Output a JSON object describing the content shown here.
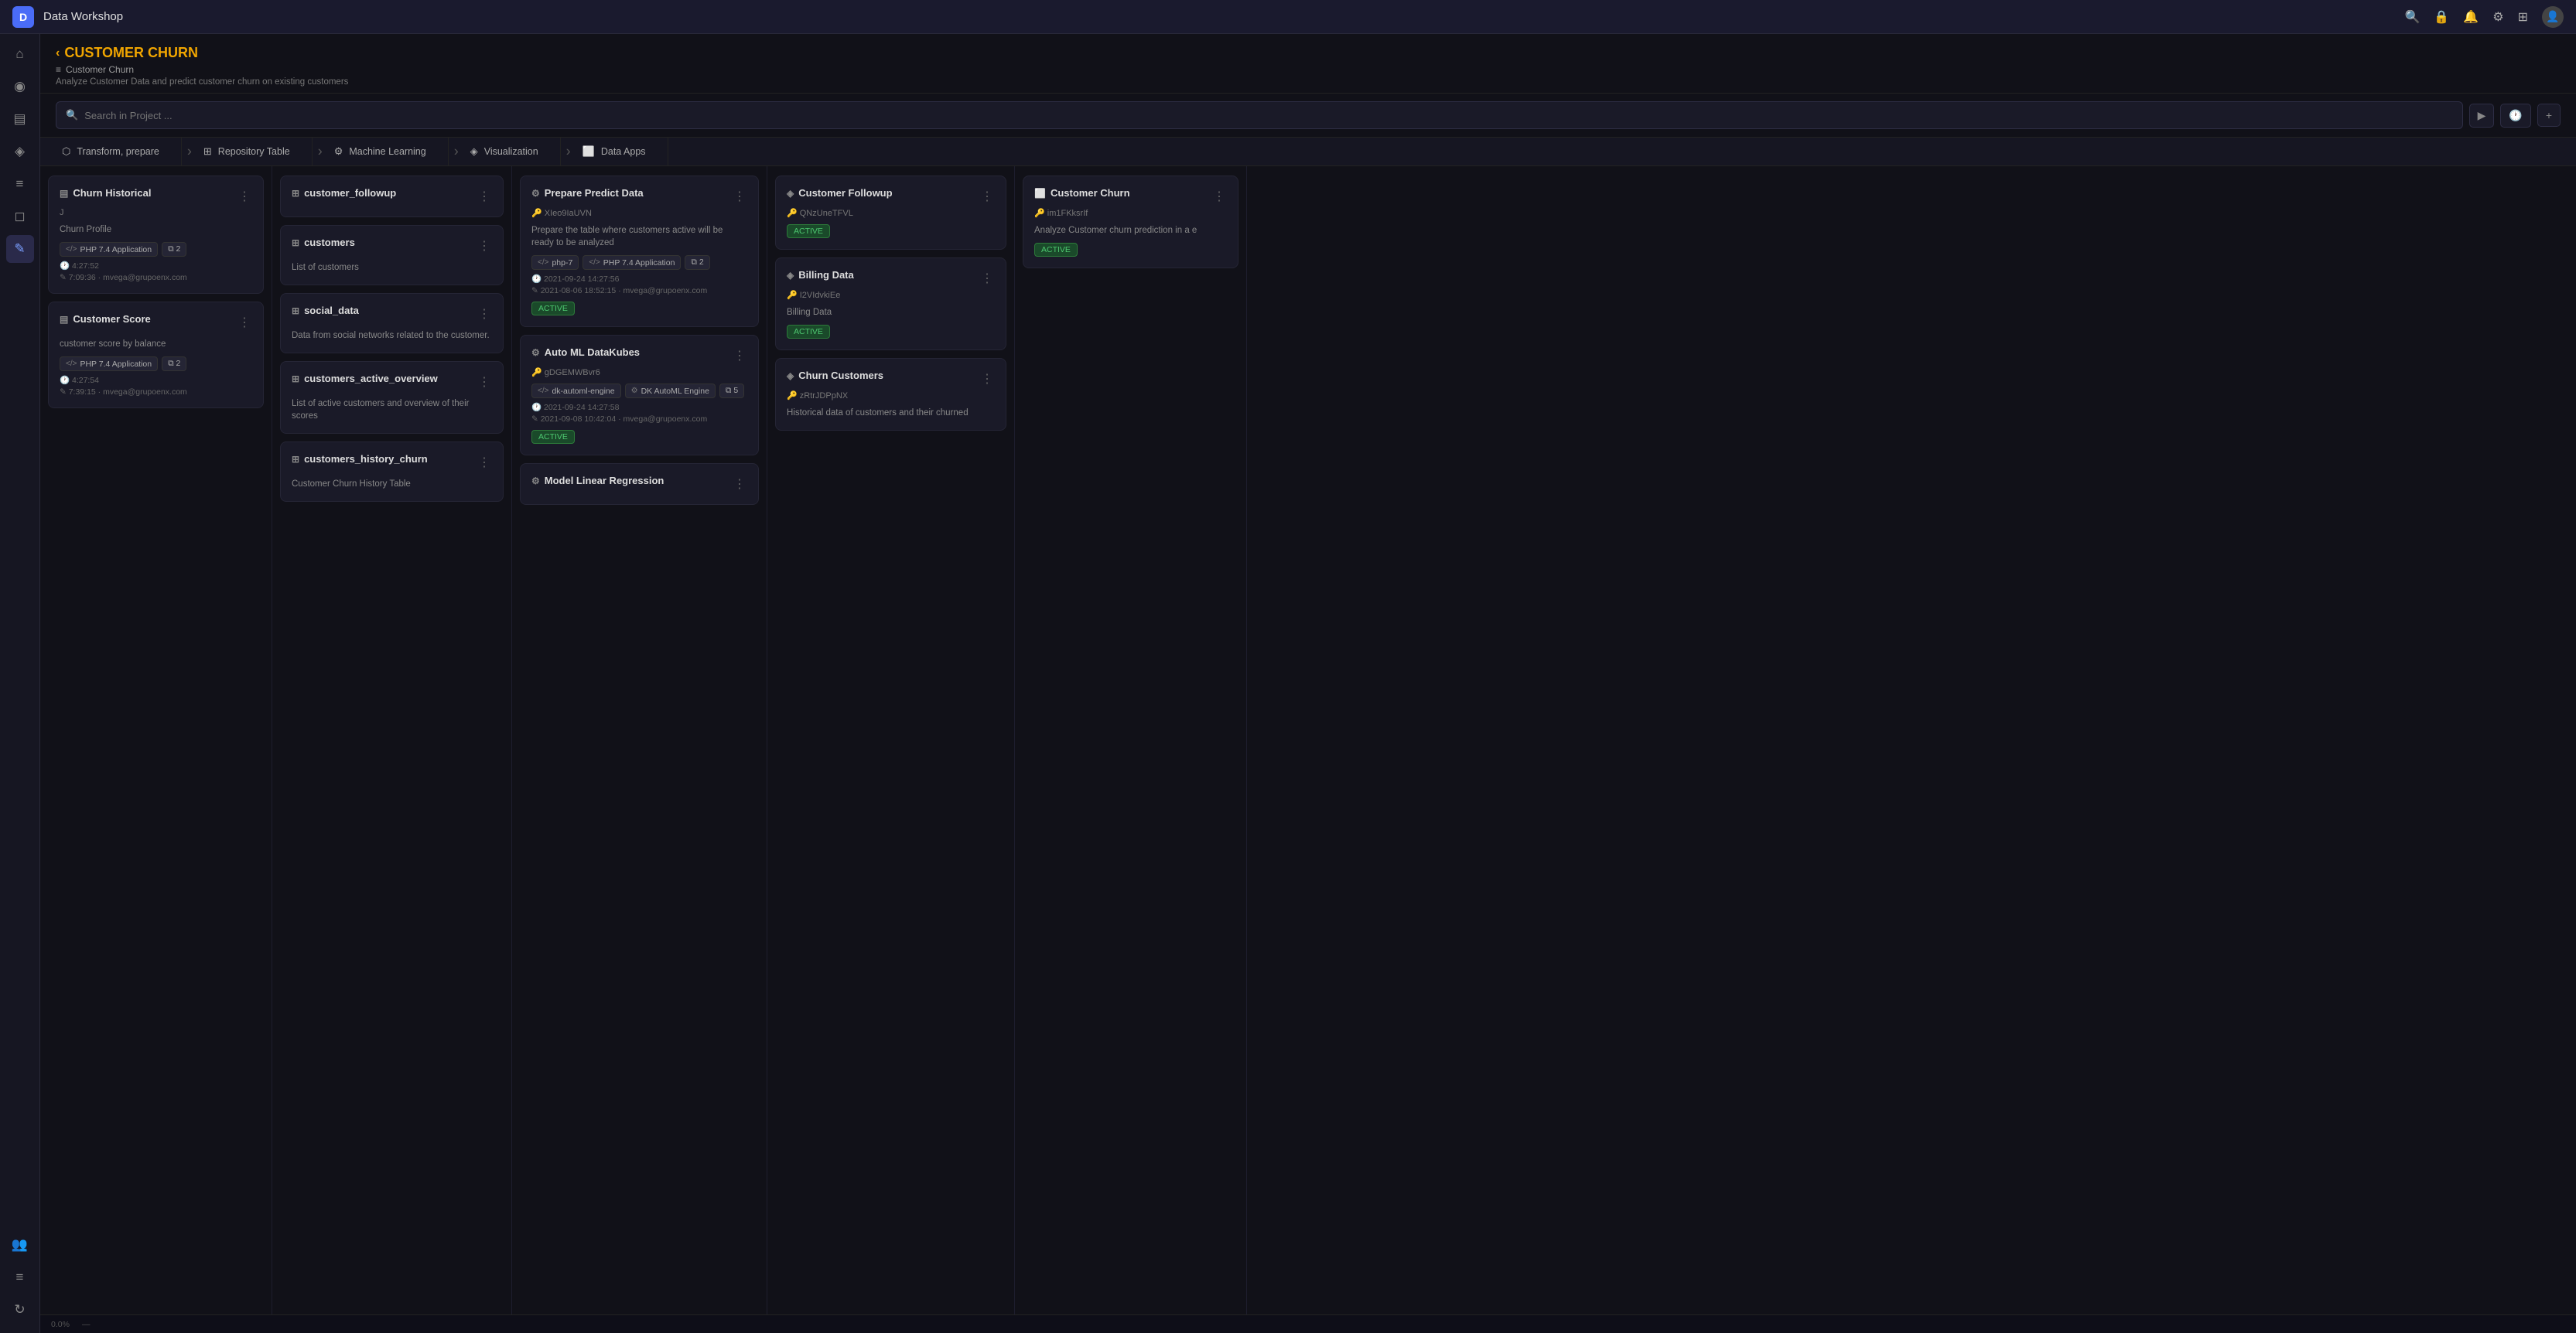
{
  "app": {
    "title": "Data Workshop",
    "logo": "D"
  },
  "topnav": {
    "icons": [
      "search",
      "lock",
      "bell",
      "settings",
      "grid",
      "user"
    ]
  },
  "sidebar": {
    "items": [
      {
        "icon": "⌂",
        "label": "home",
        "active": false
      },
      {
        "icon": "◉",
        "label": "dashboard",
        "active": false
      },
      {
        "icon": "▤",
        "label": "storage",
        "active": false
      },
      {
        "icon": "◈",
        "label": "pipeline",
        "active": false
      },
      {
        "icon": "≡",
        "label": "list",
        "active": false
      },
      {
        "icon": "✦",
        "label": "analytics",
        "active": false
      },
      {
        "icon": "✎",
        "label": "edit",
        "active": true
      },
      {
        "icon": "⊕",
        "label": "add",
        "active": false
      },
      {
        "icon": "↻",
        "label": "refresh",
        "active": false
      }
    ]
  },
  "project": {
    "back_label": "CUSTOMER CHURN",
    "subtitle": "Customer Churn",
    "description": "Analyze Customer Data and predict customer churn on existing customers"
  },
  "search": {
    "placeholder": "Search in Project ..."
  },
  "pipeline": {
    "tabs": [
      {
        "icon": "⬡",
        "label": "Transform, prepare"
      },
      {
        "icon": "⊞",
        "label": "Repository Table"
      },
      {
        "icon": "⚙",
        "label": "Machine Learning"
      },
      {
        "icon": "◈",
        "label": "Visualization"
      },
      {
        "icon": "⬜",
        "label": "Data Apps"
      }
    ]
  },
  "columns": {
    "transform": {
      "cards": [
        {
          "title": "Churn Historical",
          "icon": "▤",
          "menu": true,
          "id": "J",
          "subtitle": "Churn Profile",
          "tags": [
            "PHP 7.4 Application",
            "2"
          ],
          "timestamp": "4:27:52",
          "edit_time": "7:09:36 · mvega@grupoenx.com"
        },
        {
          "title": "Customer Score",
          "icon": "▤",
          "menu": true,
          "subtitle": "customer score by balance",
          "tags": [
            "PHP 7.4 Application",
            "2"
          ],
          "timestamp": "4:27:54",
          "edit_time": "7:39:15 · mvega@grupoenx.com"
        }
      ]
    },
    "repository": {
      "cards": [
        {
          "title": "customer_followup",
          "icon": "⊞",
          "menu": true,
          "desc": ""
        },
        {
          "title": "customers",
          "icon": "⊞",
          "menu": true,
          "desc": "List of customers"
        },
        {
          "title": "social_data",
          "icon": "⊞",
          "menu": true,
          "desc": "Data from social networks related to the customer."
        },
        {
          "title": "customers_active_overview",
          "icon": "⊞",
          "menu": true,
          "desc": "List of active customers and overview of their scores"
        },
        {
          "title": "customers_history_churn",
          "icon": "⊞",
          "menu": true,
          "desc": "Customer Churn History Table"
        }
      ]
    },
    "ml": {
      "cards": [
        {
          "title": "Prepare Predict Data",
          "icon": "⚙",
          "menu": true,
          "id": "XIeo9IaUVN",
          "desc": "Prepare the table where customers active will be ready to be analyzed",
          "tags": [
            "php-7",
            "PHP 7.4 Application",
            "2"
          ],
          "timestamp": "2021-09-24 14:27:56",
          "edit_time": "2021-08-06 18:52:15 · mvega@grupoenx.com",
          "status": "ACTIVE"
        },
        {
          "title": "Auto ML DataKubes",
          "icon": "⚙",
          "menu": true,
          "id": "gDGEMWBvr6",
          "desc": "",
          "tags": [
            "dk-automl-engine",
            "DK AutoML Engine",
            "5"
          ],
          "timestamp": "2021-09-24 14:27:58",
          "edit_time": "2021-09-08 10:42:04 · mvega@grupoenx.com",
          "status": "ACTIVE"
        },
        {
          "title": "Model Linear Regression",
          "icon": "⚙",
          "menu": true,
          "id": "",
          "desc": ""
        }
      ]
    },
    "viz": {
      "cards": [
        {
          "title": "Customer Followup",
          "icon": "◈",
          "menu": true,
          "id": "QNzUneTFVL",
          "desc": "",
          "status": "ACTIVE"
        },
        {
          "title": "Billing Data",
          "icon": "◈",
          "menu": true,
          "id": "I2VIdvkiEe",
          "desc": "Billing Data",
          "status": "ACTIVE"
        },
        {
          "title": "Churn Customers",
          "icon": "◈",
          "menu": true,
          "id": "zRtrJDPpNX",
          "desc": "Historical data of customers and their churned"
        }
      ]
    },
    "apps": {
      "cards": [
        {
          "title": "Customer Churn",
          "icon": "⬜",
          "menu": true,
          "id": "im1FKksrIf",
          "desc": "Analyze Customer churn prediction in a e",
          "status": "ACTIVE"
        }
      ]
    }
  },
  "bottom": {
    "percent": "0.0%",
    "icon": "—"
  }
}
